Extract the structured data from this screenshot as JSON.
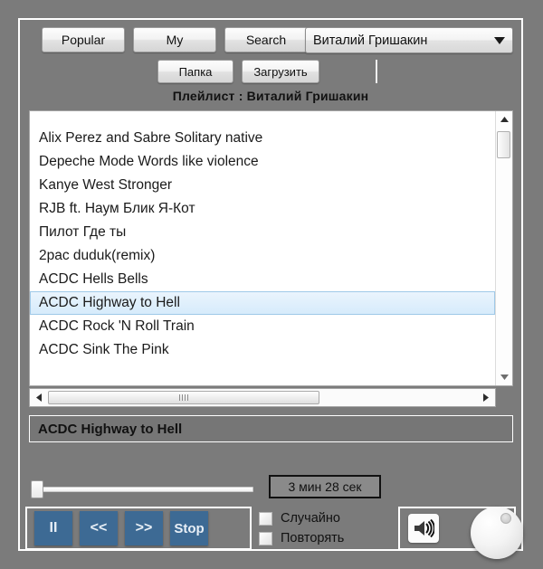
{
  "toolbar": {
    "popular_label": "Popular",
    "my_label": "My",
    "search_label": "Search",
    "folder_label": "Папка",
    "upload_label": "Загрузить"
  },
  "artist_select": {
    "selected": "Виталий Гришакин",
    "arrow_icon": "chevron-down-icon"
  },
  "playlist": {
    "title": "Плейлист : Виталий Гришакин",
    "tracks": [
      {
        "name": "Alix Perez and Sabre  Solitary native",
        "selected": false
      },
      {
        "name": "Depeche Mode Words like violence",
        "selected": false
      },
      {
        "name": "Kanye West Stronger",
        "selected": false
      },
      {
        "name": "RJB ft. Наум Блик  Я-Кот",
        "selected": false
      },
      {
        "name": "Пилот Где ты",
        "selected": false
      },
      {
        "name": "2pac duduk(remix)",
        "selected": false
      },
      {
        "name": "ACDC Hells Bells",
        "selected": false
      },
      {
        "name": "ACDC Highway to Hell",
        "selected": true
      },
      {
        "name": "ACDC Rock 'N Roll Train",
        "selected": false
      },
      {
        "name": "ACDC Sink The Pink",
        "selected": false
      }
    ],
    "vscroll_up_icon": "scroll-up-arrow-icon",
    "vscroll_down_icon": "scroll-down-arrow-icon",
    "hscroll_left_icon": "scroll-left-arrow-icon",
    "hscroll_right_icon": "scroll-right-arrow-icon"
  },
  "now_playing": {
    "track": "ACDC Highway to Hell",
    "time": "3 мин  28 сек"
  },
  "transport": {
    "pause_label": "II",
    "prev_label": "<<",
    "next_label": ">>",
    "stop_label": "Stop"
  },
  "options": {
    "shuffle_label": "Случайно",
    "shuffle_checked": false,
    "repeat_label": "Повторять",
    "repeat_checked": false
  },
  "volume": {
    "speaker_icon": "speaker-volume-icon",
    "knob_icon": "volume-knob"
  },
  "colors": {
    "background": "#7b7b7b",
    "frame_border": "#ffffff",
    "transport_button": "#3d6a94",
    "selection": "#d6ebfb",
    "list_background": "#ffffff"
  }
}
